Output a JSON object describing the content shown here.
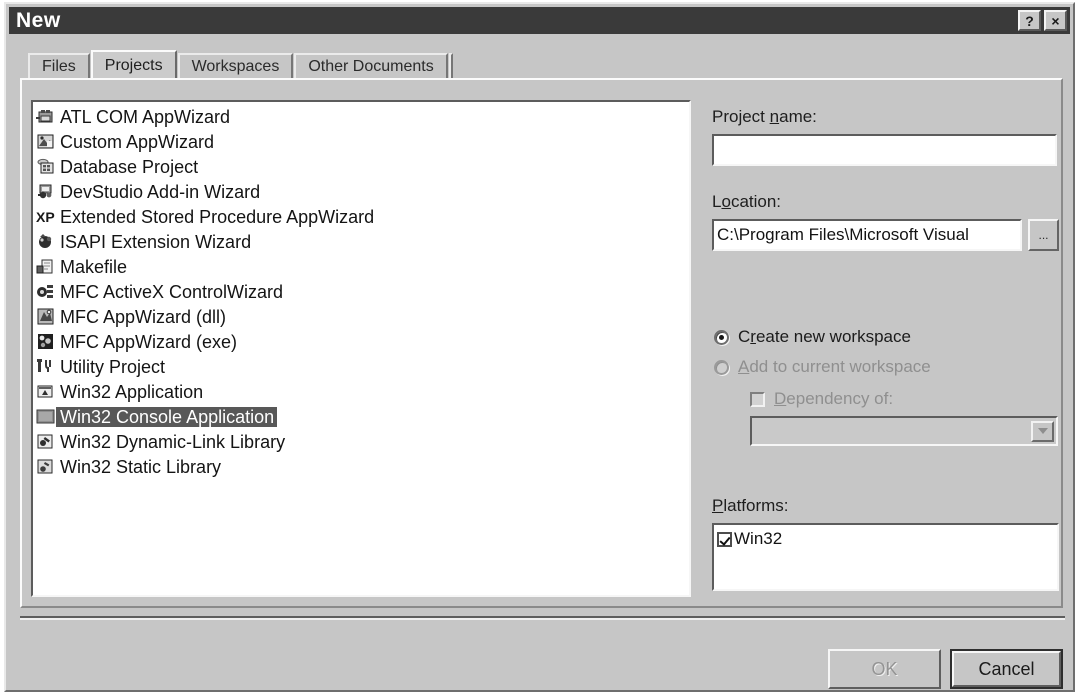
{
  "window": {
    "title": "New",
    "help_button": "?",
    "close_button": "×"
  },
  "tabs": [
    {
      "label": "Files",
      "selected": false
    },
    {
      "label": "Projects",
      "selected": true
    },
    {
      "label": "Workspaces",
      "selected": false
    },
    {
      "label": "Other Documents",
      "selected": false
    }
  ],
  "template_list": {
    "items": [
      {
        "label": "ATL COM AppWizard",
        "icon": "atl-com-appwizard-icon",
        "selected": false
      },
      {
        "label": "Custom AppWizard",
        "icon": "custom-appwizard-icon",
        "selected": false
      },
      {
        "label": "Database Project",
        "icon": "database-project-icon",
        "selected": false
      },
      {
        "label": "DevStudio Add-in Wizard",
        "icon": "devstudio-addin-wizard-icon",
        "selected": false
      },
      {
        "label": "Extended Stored Procedure AppWizard",
        "icon": "extended-stored-procedure-icon",
        "selected": false
      },
      {
        "label": "ISAPI Extension Wizard",
        "icon": "isapi-extension-wizard-icon",
        "selected": false
      },
      {
        "label": "Makefile",
        "icon": "makefile-icon",
        "selected": false
      },
      {
        "label": "MFC ActiveX ControlWizard",
        "icon": "mfc-activex-controlwizard-icon",
        "selected": false
      },
      {
        "label": "MFC AppWizard (dll)",
        "icon": "mfc-appwizard-dll-icon",
        "selected": false
      },
      {
        "label": "MFC AppWizard (exe)",
        "icon": "mfc-appwizard-exe-icon",
        "selected": false
      },
      {
        "label": "Utility Project",
        "icon": "utility-project-icon",
        "selected": false
      },
      {
        "label": "Win32 Application",
        "icon": "win32-application-icon",
        "selected": false
      },
      {
        "label": "Win32 Console Application",
        "icon": "win32-console-application-icon",
        "selected": true
      },
      {
        "label": "Win32 Dynamic-Link Library",
        "icon": "win32-dll-icon",
        "selected": false
      },
      {
        "label": "Win32 Static Library",
        "icon": "win32-static-library-icon",
        "selected": false
      }
    ]
  },
  "project_name": {
    "label_pre": "Project ",
    "label_acc": "n",
    "label_post": "ame:",
    "value": "",
    "placeholder": ""
  },
  "location": {
    "label_pre": "L",
    "label_acc": "o",
    "label_post": "cation:",
    "value": "C:\\Program Files\\Microsoft Visual",
    "browse_label": "..."
  },
  "workspace_options": {
    "create_new": {
      "label_pre": "C",
      "label_acc": "r",
      "label_post": "eate new workspace",
      "checked": true,
      "enabled": true
    },
    "add_current": {
      "label_pre": "",
      "label_acc": "A",
      "label_post": "dd to current workspace",
      "checked": false,
      "enabled": false
    },
    "dependency_of": {
      "label_pre": "",
      "label_acc": "D",
      "label_post": "ependency of:",
      "checked": false,
      "enabled": false
    },
    "dependency_combo": {
      "value": "",
      "enabled": false
    }
  },
  "platforms": {
    "label_pre": "",
    "label_acc": "P",
    "label_post": "latforms:",
    "items": [
      {
        "label": "Win32",
        "checked": true
      }
    ]
  },
  "buttons": {
    "ok": {
      "label": "OK",
      "enabled": false,
      "default": false
    },
    "cancel": {
      "label": "Cancel",
      "enabled": true,
      "default": true
    }
  },
  "colors": {
    "dialog_face": "#c6c6c6",
    "titlebar": "#3a3a3a",
    "titlebar_text": "#ffffff",
    "selection": "#585858",
    "selection_text": "#ffffff",
    "disabled_text": "#8f8f8f",
    "field_background": "#ffffff"
  }
}
